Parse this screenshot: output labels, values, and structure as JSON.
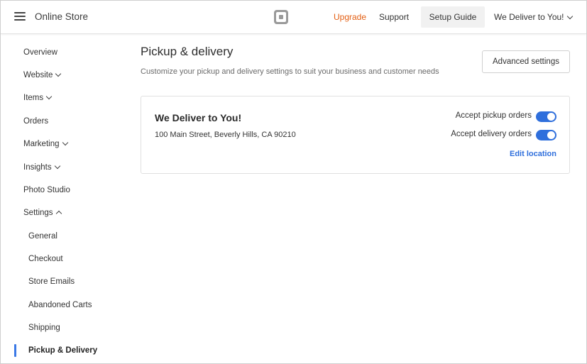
{
  "header": {
    "app_title": "Online Store",
    "upgrade_label": "Upgrade",
    "support_label": "Support",
    "setup_guide_label": "Setup Guide",
    "account_label": "We Deliver to You!",
    "menu_icon": "hamburger-menu-icon",
    "logo_icon": "square-logo-icon"
  },
  "sidebar": {
    "items": [
      {
        "label": "Overview"
      },
      {
        "label": "Website",
        "expandable": true
      },
      {
        "label": "Items",
        "expandable": true
      },
      {
        "label": "Orders"
      },
      {
        "label": "Marketing",
        "expandable": true
      },
      {
        "label": "Insights",
        "expandable": true
      },
      {
        "label": "Photo Studio"
      },
      {
        "label": "Settings",
        "expandable": true,
        "expanded": true
      }
    ],
    "settings_children": [
      {
        "label": "General"
      },
      {
        "label": "Checkout"
      },
      {
        "label": "Store Emails"
      },
      {
        "label": "Abandoned Carts"
      },
      {
        "label": "Shipping"
      },
      {
        "label": "Pickup & Delivery",
        "active": true
      }
    ]
  },
  "main": {
    "title": "Pickup & delivery",
    "subtitle": "Customize your pickup and delivery settings to suit your business and customer needs",
    "advanced_button": "Advanced settings",
    "location": {
      "name": "We Deliver to You!",
      "address": "100 Main Street, Beverly Hills, CA 90210",
      "pickup_label": "Accept pickup orders",
      "pickup_enabled": true,
      "delivery_label": "Accept delivery orders",
      "delivery_enabled": true,
      "edit_label": "Edit location"
    }
  },
  "colors": {
    "accent": "#2f6fdc",
    "upgrade": "#e35f13",
    "active_indicator": "#3b79e6"
  }
}
